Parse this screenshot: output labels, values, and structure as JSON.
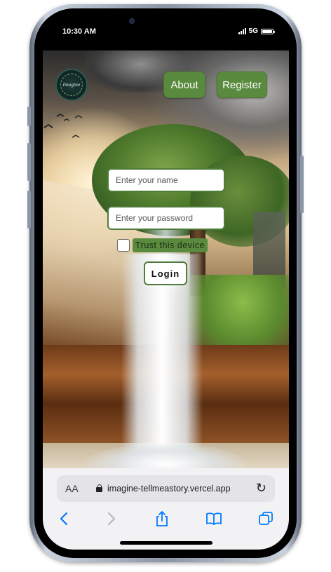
{
  "status_bar": {
    "time": "10:30 AM",
    "network": "5G"
  },
  "site": {
    "logo_text": "Imagine",
    "nav": {
      "about_label": "About",
      "register_label": "Register"
    },
    "login_form": {
      "name_placeholder": "Enter your name",
      "password_placeholder": "Enter your password",
      "trust_label": "Trust this device",
      "login_label": "Login"
    }
  },
  "browser": {
    "reader_label": "AA",
    "url": "imagine-tellmeastory.vercel.app"
  },
  "colors": {
    "accent_green": "#5a8a3e",
    "field_border": "#4f7c3a",
    "safari_blue": "#007aff"
  },
  "icons": [
    "lock-icon",
    "reload-icon",
    "back-icon",
    "forward-icon",
    "share-icon",
    "bookmarks-icon",
    "tabs-icon"
  ]
}
